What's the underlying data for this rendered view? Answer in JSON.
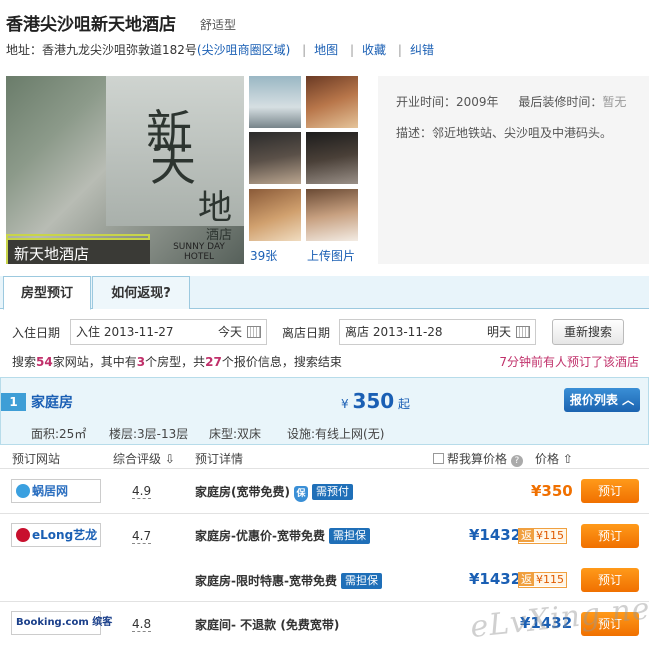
{
  "hotel": {
    "name": "香港尖沙咀新天地酒店",
    "type": "舒适型",
    "address_label": "地址：香港九龙尖沙咀弥敦道182号",
    "area": "(尖沙咀商圈区域)",
    "links": [
      "地图",
      "收藏",
      "纠错"
    ]
  },
  "gallery": {
    "main_sign_chars": [
      "新",
      "天",
      "地"
    ],
    "main_sign_sub": "酒店",
    "small_sign": "新天地酒店",
    "sunny_text": "SUNNY DAY HOTEL",
    "photo_count": "39张",
    "upload": "上传图片"
  },
  "info": {
    "opened_label": "开业时间：",
    "opened_value": "2009年",
    "renovated_label": "最后装修时间：",
    "renovated_value": "暂无",
    "desc_label": "描述：",
    "desc_value": "邻近地铁站、尖沙咀及中港码头。"
  },
  "tabs": [
    "房型预订",
    "如何返现?"
  ],
  "search": {
    "checkin_label": "入住日期",
    "checkin_value": "入住 2013-11-27",
    "checkin_rel": "今天",
    "checkout_label": "离店日期",
    "checkout_value": "离店 2013-11-28",
    "checkout_rel": "明天",
    "button": "重新搜索"
  },
  "stats": {
    "p1": "搜索",
    "sites": "54",
    "p2": "家网站，其中有",
    "rooms": "3",
    "p3": "个房型，共",
    "offers": "27",
    "p4": "个报价信息，搜索结束",
    "recent": "7分钟前有人预订了该酒店"
  },
  "room": {
    "index": "1",
    "name": "家庭房",
    "currency": "¥",
    "price": "350",
    "suffix": "起",
    "price_list_button": "报价列表 ︿",
    "specs": [
      "面积:25㎡",
      "楼层:3层-13层",
      "床型:双床",
      "设施:有线上网(无)"
    ]
  },
  "columns": {
    "site": "预订网站",
    "rating": "综合评级 ⇩",
    "detail": "预订详情",
    "calc": "帮我算价格",
    "price": "价格 ⇧"
  },
  "offers": [
    {
      "site": "蜗居网",
      "score": "4.9",
      "deal": "家庭房(宽带免费)",
      "shield": "保",
      "tag": "需预付",
      "price": "¥350",
      "cashback_label": "",
      "cashback": "",
      "book": "预订"
    },
    {
      "site": "eLong艺龙",
      "score": "4.7",
      "deal": "家庭房-优惠价-宽带免费",
      "shield": "",
      "tag": "需担保",
      "price": "¥1432",
      "cashback_label": "返",
      "cashback": "¥115",
      "book": "预订"
    },
    {
      "site": "",
      "score": "",
      "deal": "家庭房-限时特惠-宽带免费",
      "shield": "",
      "tag": "需担保",
      "price": "¥1432",
      "cashback_label": "返",
      "cashback": "¥115",
      "book": "预订"
    },
    {
      "site": "Booking.com 缤客",
      "score": "4.8",
      "deal": "家庭间- 不退款 (免费宽带)",
      "shield": "",
      "tag": "",
      "price": "¥1432",
      "cashback_label": "",
      "cashback": "",
      "book": "预订"
    }
  ],
  "watermark": "eLvXing.net"
}
